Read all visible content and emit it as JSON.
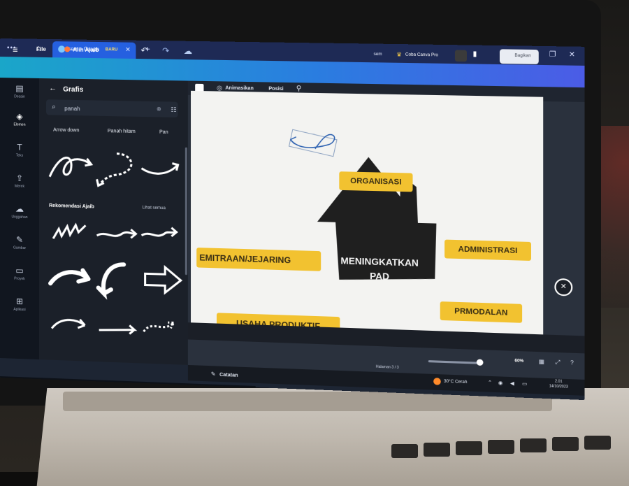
{
  "window": {
    "tab_title": "sem - Graph",
    "controls": [
      "—",
      "❐",
      "✕"
    ]
  },
  "toolbar": {
    "file_label": "File",
    "resize_label": "Alih Ajaib",
    "resize_badge": "BARU",
    "doc_name": "sem",
    "pro_label": "Coba Canva Pro",
    "share_label": "Bagikan"
  },
  "rail": {
    "items": [
      {
        "icon": "▤",
        "label": "Desain"
      },
      {
        "icon": "◈",
        "label": "Elemen"
      },
      {
        "icon": "T",
        "label": "Teks"
      },
      {
        "icon": "⇪",
        "label": "Merek"
      },
      {
        "icon": "☁",
        "label": "Unggahan"
      },
      {
        "icon": "✎",
        "label": "Gambar"
      },
      {
        "icon": "▭",
        "label": "Proyek"
      },
      {
        "icon": "⊞",
        "label": "Aplikasi"
      }
    ]
  },
  "panel": {
    "title": "Grafis",
    "search_value": "panah",
    "chips": [
      "Arrow down",
      "Panah hitam",
      "Pan"
    ],
    "section_title": "Rekomendasi Ajaib",
    "section_link": "Lihat semua"
  },
  "canvas_toolbar": {
    "animate_label": "Animasikan",
    "position_label": "Posisi"
  },
  "slide": {
    "organisasi": "ORGANISASI",
    "kemitraan": "EMITRAAN/JEJARING",
    "administrasi": "ADMINISTRASI",
    "usaha": "USAHA PRODUKTIF",
    "permodalan": "PRMODALAN",
    "center_line1": "MENINGKATKAN",
    "center_line2": "PAD",
    "colors": {
      "pill": "#f2c230",
      "house": "#1f1f1f",
      "background": "#f3f3f1"
    }
  },
  "status": {
    "page_label": "Halaman 3 / 3",
    "zoom": "60%",
    "notes_label": "Catatan"
  },
  "taskbar": {
    "weather": "30°C Cerah",
    "time": "2.01",
    "date": "14/10/2023"
  }
}
